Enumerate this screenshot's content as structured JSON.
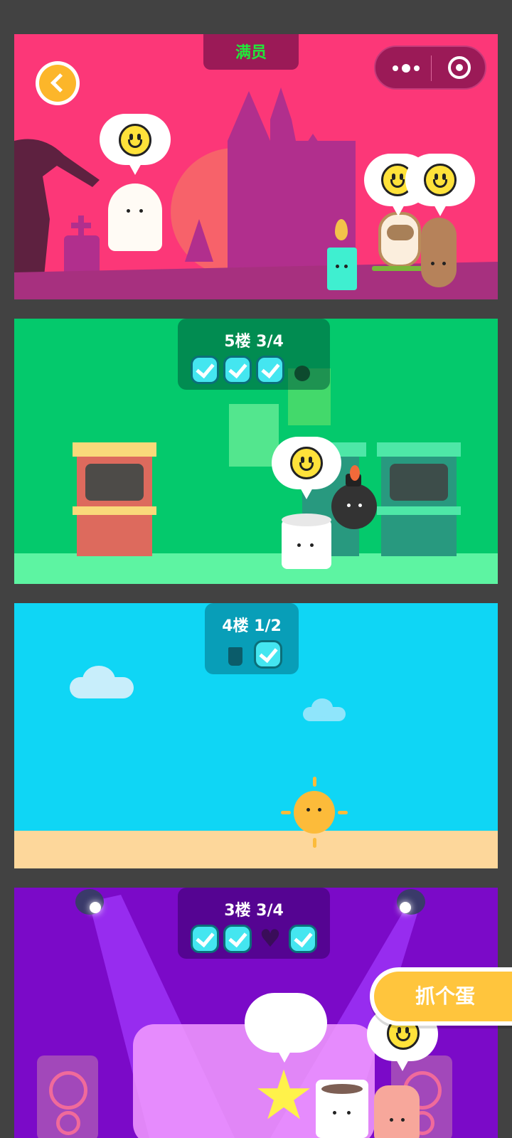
{
  "header": {
    "status_label": "满员"
  },
  "capsule": {
    "more_icon": "more-dots-icon",
    "close_icon": "target-circle-icon"
  },
  "back_icon": "chevron-left-icon",
  "floors": {
    "f5": {
      "title": "5楼 3/4"
    },
    "f4": {
      "title": "4楼 1/2"
    },
    "f3": {
      "title": "3楼 3/4"
    }
  },
  "catch_button": {
    "label": "抓个蛋"
  },
  "colors": {
    "floor6_bg": "#fc3778",
    "floor5_bg": "#04c96c",
    "floor4_bg": "#0fd6f5",
    "floor3_bg": "#7b0ac8",
    "button_yellow": "#ffc53d"
  }
}
